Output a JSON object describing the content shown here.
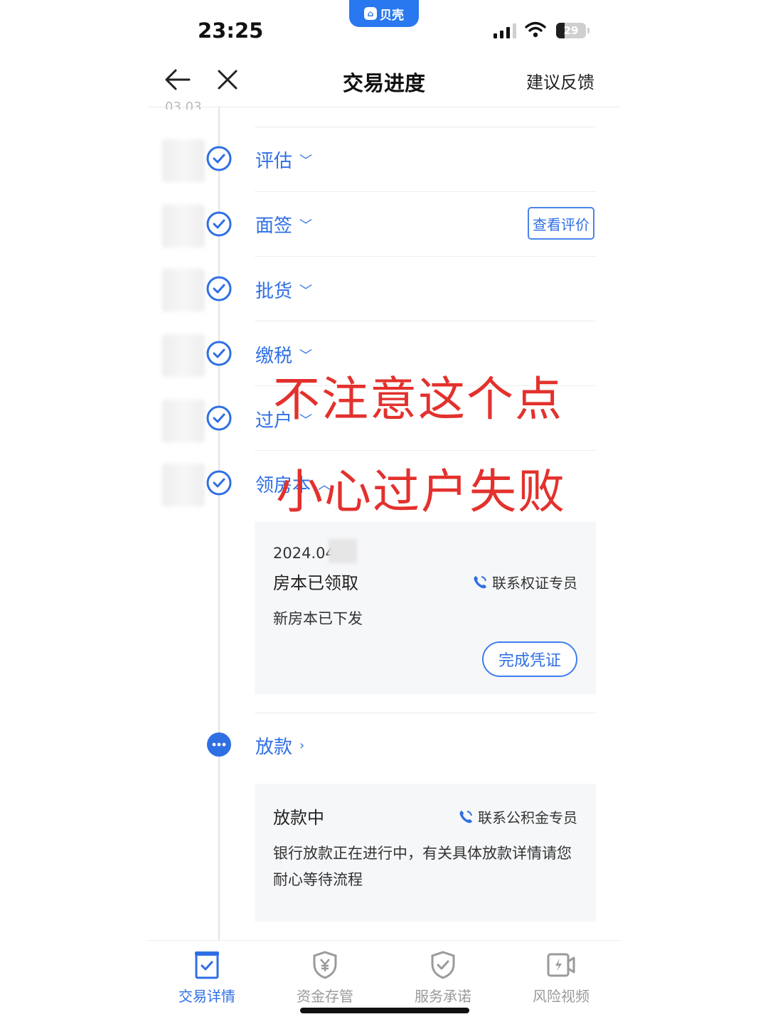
{
  "status_bar": {
    "time": "23:25",
    "app_badge": "贝壳",
    "battery": "29",
    "battery_level": 0.29
  },
  "nav": {
    "title": "交易进度",
    "feedback": "建议反馈"
  },
  "timeline": {
    "steps": [
      {
        "label": "评估",
        "state": "done"
      },
      {
        "label": "面签",
        "state": "done",
        "action": "查看评价"
      },
      {
        "label": "批货",
        "state": "done"
      },
      {
        "label": "缴税",
        "state": "done"
      },
      {
        "label": "过户",
        "state": "done"
      },
      {
        "label": "领房本",
        "state": "done"
      },
      {
        "label": "放款",
        "state": "in_progress"
      }
    ],
    "card_deed": {
      "date": "2024.04",
      "title": "房本已领取",
      "contact": "联系权证专员",
      "desc": "新房本已下发",
      "button": "完成凭证"
    },
    "card_loan": {
      "title": "放款中",
      "contact": "联系公积金专员",
      "desc": "银行放款正在进行中，有关具体放款详情请您耐心等待流程"
    }
  },
  "overlay": {
    "line1": "不注意这个点",
    "line2": "小心过户失败"
  },
  "tabbar": {
    "tabs": [
      {
        "label": "交易详情",
        "icon": "clipboard-check-icon",
        "active": true
      },
      {
        "label": "资金存管",
        "icon": "shield-yuan-icon",
        "active": false
      },
      {
        "label": "服务承诺",
        "icon": "shield-check-icon",
        "active": false
      },
      {
        "label": "风险视频",
        "icon": "video-bolt-icon",
        "active": false
      }
    ]
  },
  "colors": {
    "accent": "#2f6fe4",
    "overlay_red": "#e3312d",
    "card_bg": "#f6f7f9"
  }
}
